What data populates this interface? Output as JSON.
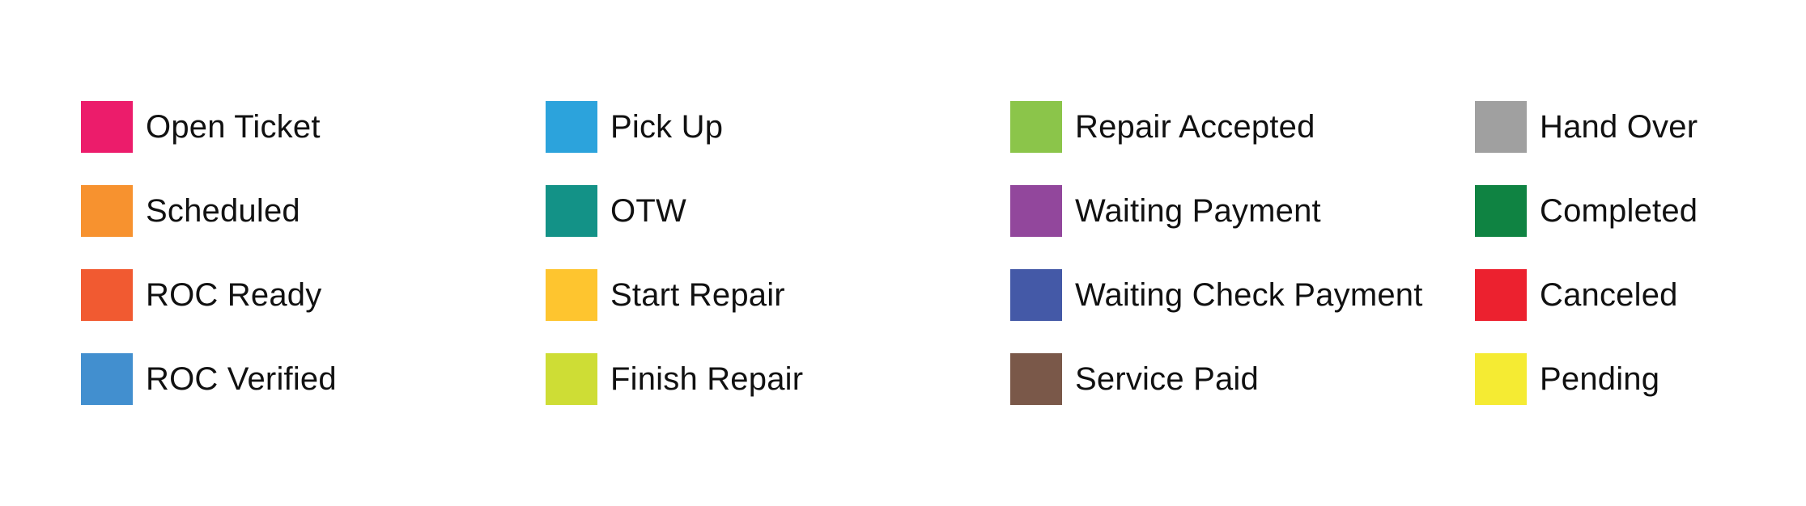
{
  "legend": {
    "items": [
      {
        "label": "Open Ticket",
        "color": "#ec1c6b"
      },
      {
        "label": "Scheduled",
        "color": "#f7922f"
      },
      {
        "label": "ROC Ready",
        "color": "#f15a31"
      },
      {
        "label": "ROC Verified",
        "color": "#428fcf"
      },
      {
        "label": "Pick Up",
        "color": "#2ca3dc"
      },
      {
        "label": "OTW",
        "color": "#139287"
      },
      {
        "label": "Start Repair",
        "color": "#fec52f"
      },
      {
        "label": "Finish Repair",
        "color": "#cedd35"
      },
      {
        "label": "Repair Accepted",
        "color": "#8bc54a"
      },
      {
        "label": "Waiting Payment",
        "color": "#92479c"
      },
      {
        "label": "Waiting Check Payment",
        "color": "#4459a7"
      },
      {
        "label": "Service Paid",
        "color": "#7a5849"
      },
      {
        "label": "Hand Over",
        "color": "#a0a0a0"
      },
      {
        "label": "Completed",
        "color": "#0f8342"
      },
      {
        "label": "Canceled",
        "color": "#ec212f"
      },
      {
        "label": "Pending",
        "color": "#f5eb33"
      }
    ]
  }
}
